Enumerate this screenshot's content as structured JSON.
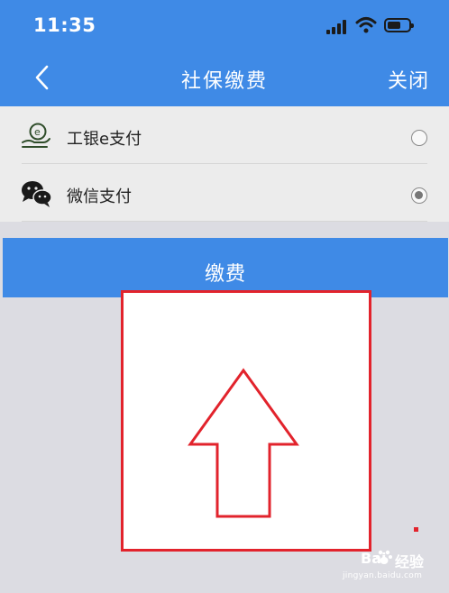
{
  "status_bar": {
    "time": "11:35"
  },
  "nav": {
    "title": "社保缴费",
    "close_label": "关闭"
  },
  "payment_options": [
    {
      "label": "工银e支付",
      "icon": "icbc-epay-icon",
      "selected": false
    },
    {
      "label": "微信支付",
      "icon": "wechat-icon",
      "selected": true
    }
  ],
  "pay_button": {
    "label": "缴费"
  },
  "watermark": {
    "main": "Bai",
    "main2": "经验",
    "sub": "jingyan.baidu.com"
  },
  "colors": {
    "brand_blue": "#3f8ae6",
    "annotation_red": "#e2232c"
  }
}
